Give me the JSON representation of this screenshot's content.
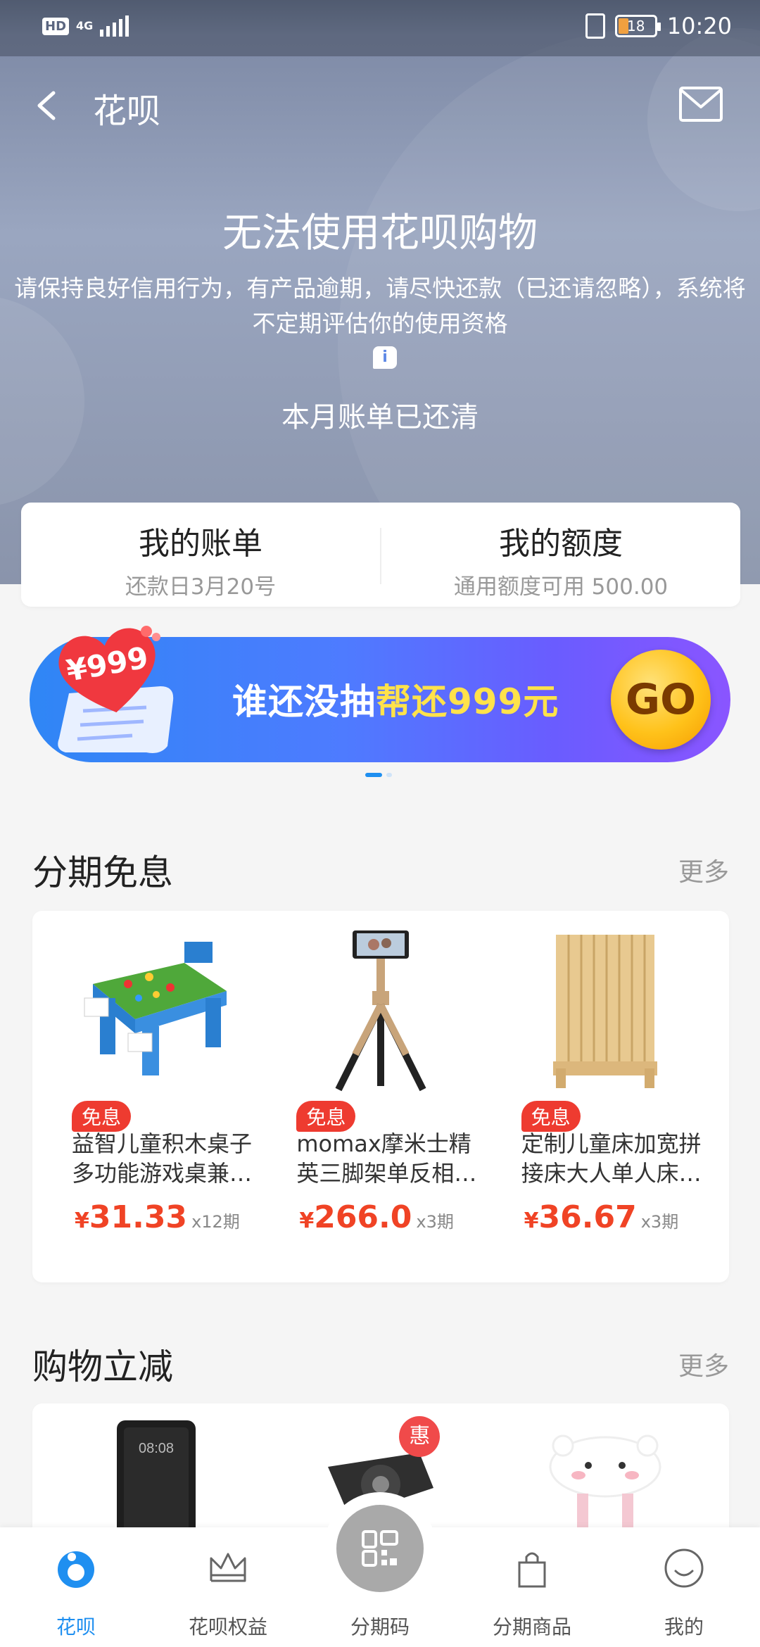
{
  "status_bar": {
    "hd": "HD",
    "network": "4G",
    "battery": "18",
    "time": "10:20"
  },
  "nav": {
    "title": "花呗"
  },
  "hero": {
    "title": "无法使用花呗购物",
    "description": "请保持良好信用行为，有产品逾期，请尽快还款（已还请忽略），系统将不定期评估你的使用资格",
    "info": "i",
    "paid_status": "本月账单已还清"
  },
  "account": {
    "bill_title": "我的账单",
    "bill_sub": "还款日3月20号",
    "limit_title": "我的额度",
    "limit_sub": "通用额度可用 500.00"
  },
  "banner": {
    "heart_text": "¥999",
    "text_main": "谁还没抽",
    "text_highlight": "帮还999元",
    "go": "GO"
  },
  "installment_free": {
    "title": "分期免息",
    "more": "更多",
    "products": [
      {
        "tag": "免息",
        "name": "益智儿童积木桌子多功能游戏桌兼…",
        "currency": "¥",
        "price": "31.33",
        "term": "x12期"
      },
      {
        "tag": "免息",
        "name": "momax摩米士精英三脚架单反相…",
        "currency": "¥",
        "price": "266.0",
        "term": "x3期"
      },
      {
        "tag": "免息",
        "name": "定制儿童床加宽拼接床大人单人床…",
        "currency": "¥",
        "price": "36.67",
        "term": "x3期"
      }
    ]
  },
  "shopping_discount": {
    "title": "购物立减",
    "more": "更多",
    "phone_time": "08:08",
    "promo_badge": "惠"
  },
  "tabbar": {
    "items": [
      {
        "label": "花呗",
        "active": true
      },
      {
        "label": "花呗权益",
        "active": false
      },
      {
        "label": "分期码",
        "active": false
      },
      {
        "label": "分期商品",
        "active": false
      },
      {
        "label": "我的",
        "active": false
      }
    ]
  },
  "colors": {
    "accent": "#1f8ff0",
    "price": "#f04325",
    "tag": "#ee3b30",
    "hero": "#8a94ab"
  }
}
